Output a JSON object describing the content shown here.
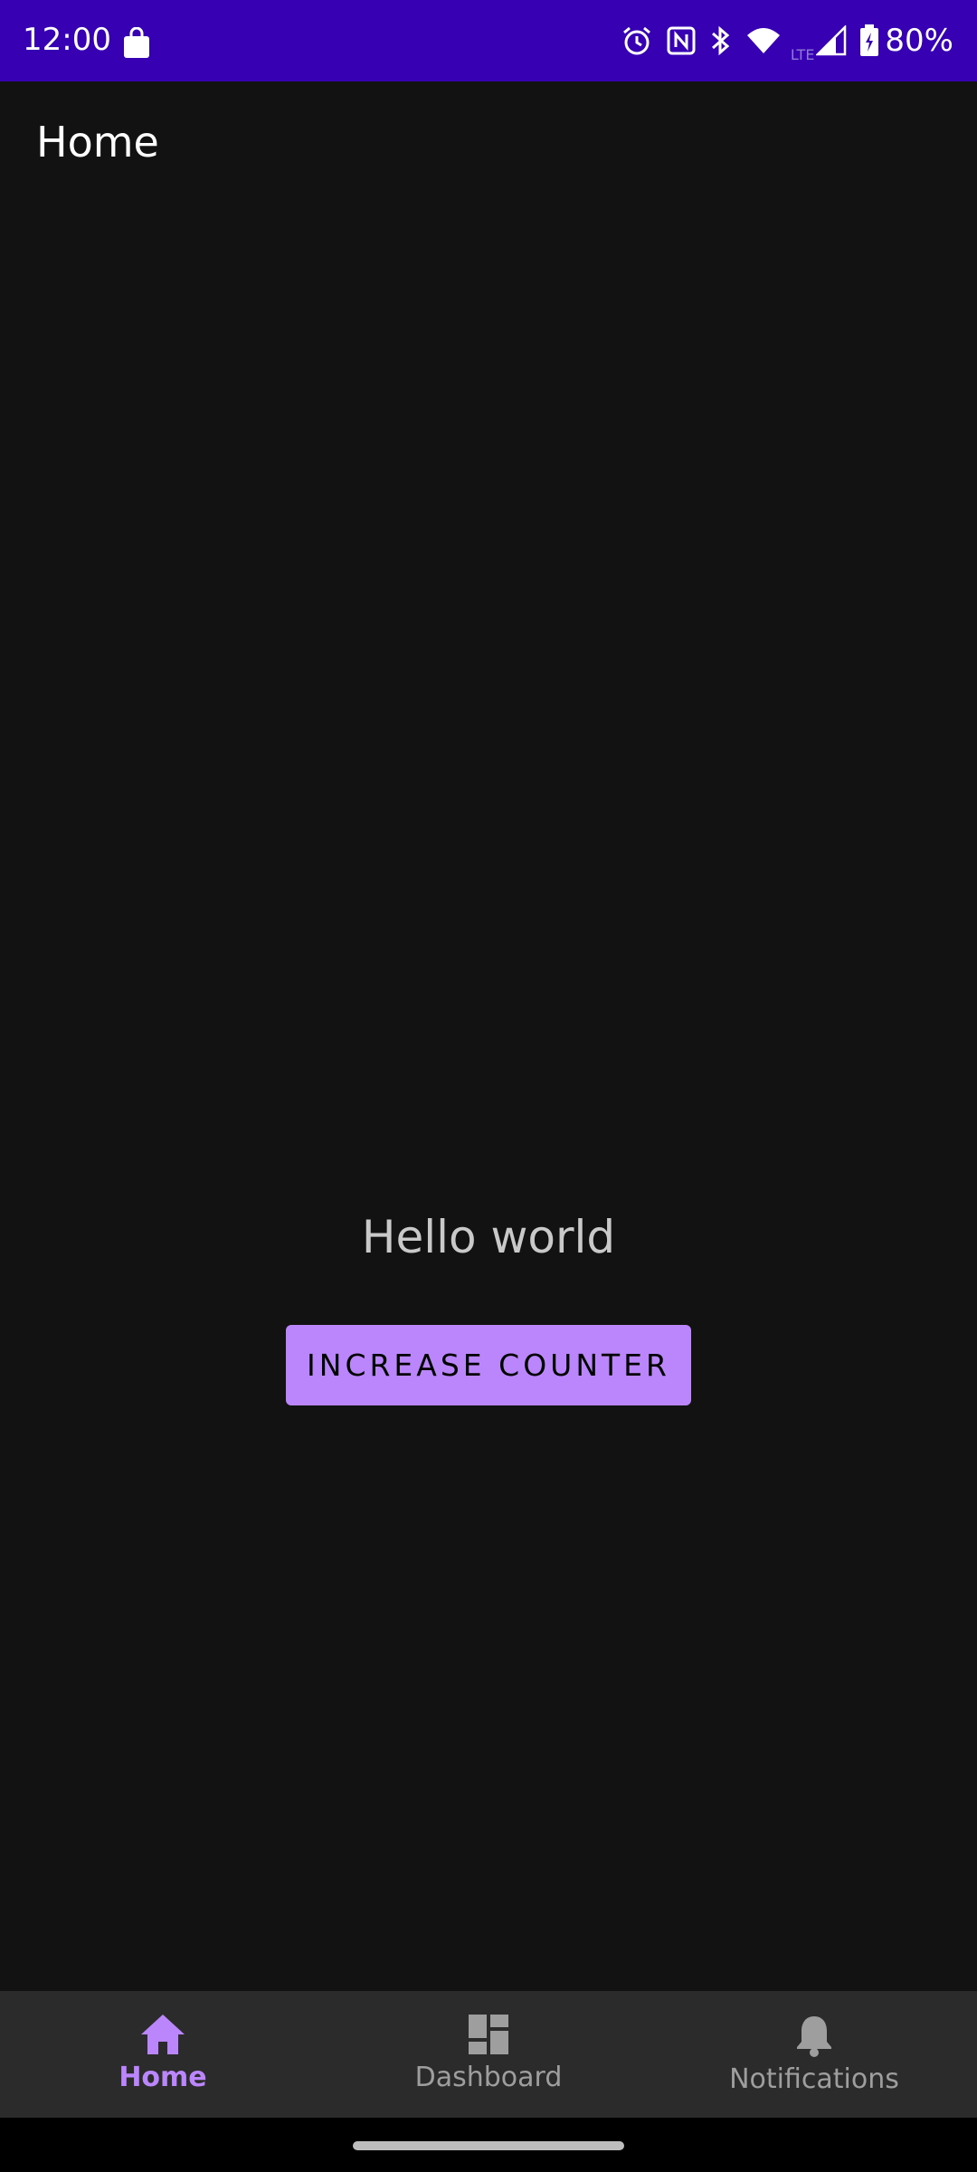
{
  "status_bar": {
    "time": "12:00",
    "battery": "80%",
    "network_label": "LTE",
    "icons": [
      "shopping-bag-icon",
      "alarm-icon",
      "nfc-icon",
      "bluetooth-icon",
      "wifi-icon",
      "signal-icon",
      "battery-charging-icon"
    ]
  },
  "header": {
    "title": "Home"
  },
  "main": {
    "message": "Hello world",
    "button_label": "INCREASE COUNTER"
  },
  "bottom_nav": {
    "items": [
      {
        "label": "Home",
        "icon": "home-icon",
        "active": true
      },
      {
        "label": "Dashboard",
        "icon": "dashboard-icon",
        "active": false
      },
      {
        "label": "Notifications",
        "icon": "bell-icon",
        "active": false
      }
    ]
  },
  "colors": {
    "status_bar": "#3700b3",
    "background": "#121212",
    "accent": "#bb86fc",
    "nav_background": "#2b2b2b",
    "inactive": "#9e9e9e"
  }
}
